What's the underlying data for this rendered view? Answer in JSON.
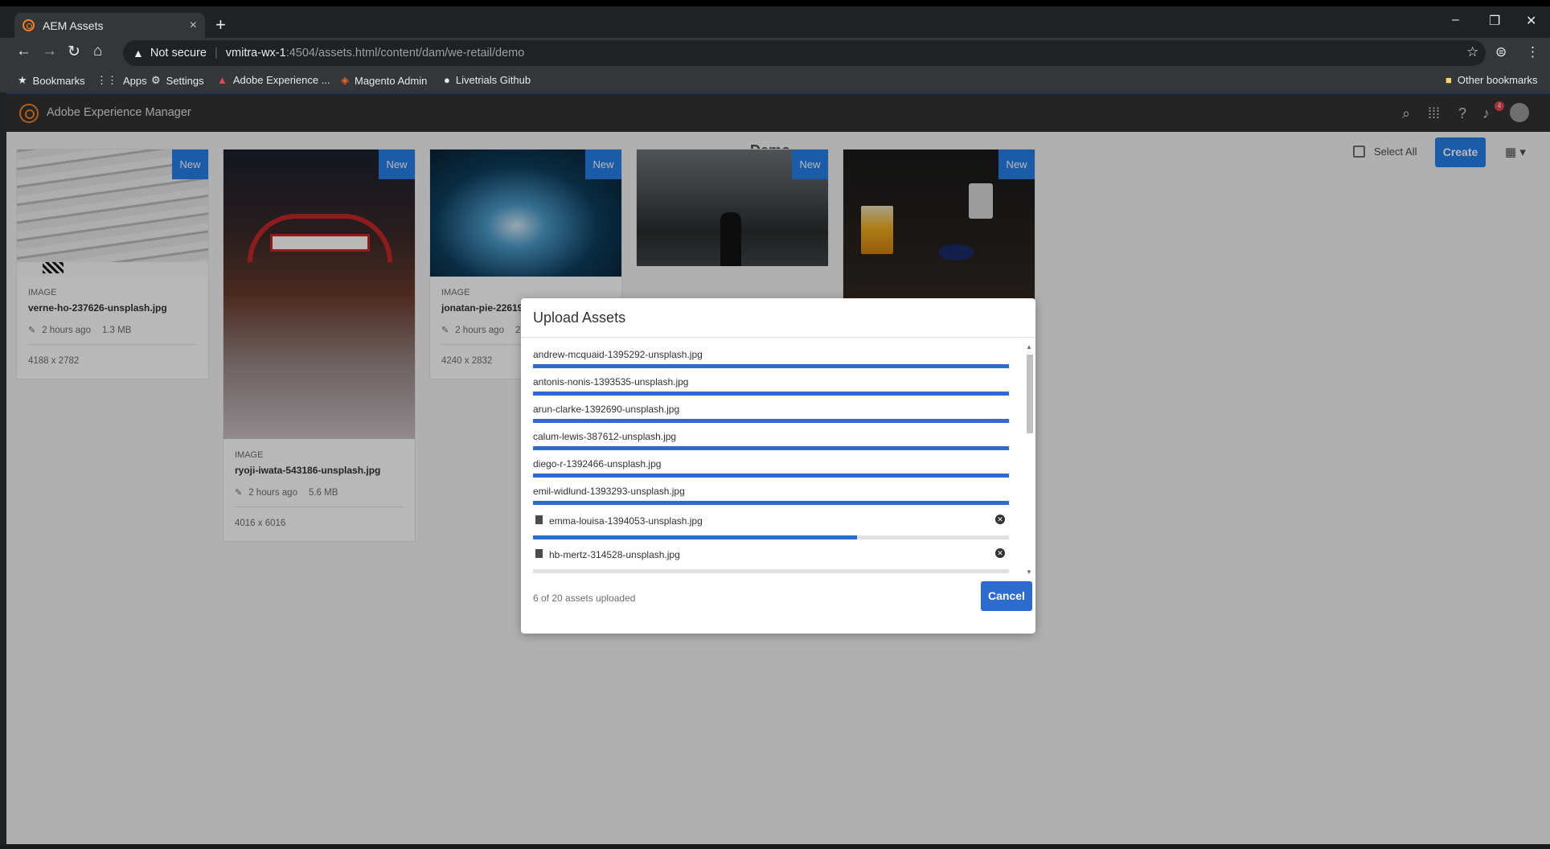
{
  "browser": {
    "tab_title": "AEM Assets",
    "tab_close": "×",
    "new_tab": "+",
    "address": {
      "security": "Not secure",
      "host": "vmitra-wx-1",
      "path": ":4504/assets.html/content/dam/we-retail/demo"
    },
    "window_controls": [
      "–",
      "❐",
      "✕"
    ],
    "bookmarks": [
      {
        "label": "Bookmarks",
        "icon": "star-icon"
      },
      {
        "label": "Apps",
        "icon": "apps-grid-icon"
      },
      {
        "label": "Settings",
        "icon": "gear-icon"
      },
      {
        "label": "Adobe Experience ...",
        "icon": "adobe-icon"
      },
      {
        "label": "Magento Admin",
        "icon": "magento-icon"
      },
      {
        "label": "Livetrials Github",
        "icon": "github-icon"
      }
    ],
    "other_bookmarks": "Other bookmarks"
  },
  "aem": {
    "product_title": "Adobe Experience Manager",
    "notification_count": "4",
    "folder_title": "Demo",
    "select_all_label": "Select All",
    "create_label": "Create",
    "new_badge": "New",
    "cards": [
      {
        "type": "IMAGE",
        "filename": "verne-ho-237626-unsplash.jpg",
        "modified": "2 hours ago",
        "size": "1.3 MB",
        "dimensions": "4188 x 2782"
      },
      {
        "type": "IMAGE",
        "filename": "ryoji-iwata-543186-unsplash.jpg",
        "modified": "2 hours ago",
        "size": "5.6 MB",
        "dimensions": "4016 x 6016"
      },
      {
        "type": "IMAGE",
        "filename": "jonatan-pie-22619",
        "modified": "2 hours ago",
        "size": "2",
        "dimensions": "4240 x 2832"
      },
      {
        "type": "",
        "filename": "",
        "modified": "",
        "size": "",
        "dimensions": ""
      },
      {
        "type": "",
        "filename": "",
        "modified": "",
        "size": "",
        "dimensions": ""
      }
    ]
  },
  "upload_dialog": {
    "title": "Upload Assets",
    "items": [
      {
        "filename": "andrew-mcquaid-1395292-unsplash.jpg",
        "progress": 1.0
      },
      {
        "filename": "antonis-nonis-1393535-unsplash.jpg",
        "progress": 1.0
      },
      {
        "filename": "arun-clarke-1392690-unsplash.jpg",
        "progress": 1.0
      },
      {
        "filename": "calum-lewis-387612-unsplash.jpg",
        "progress": 1.0
      },
      {
        "filename": "diego-r-1392466-unsplash.jpg",
        "progress": 1.0
      },
      {
        "filename": "emil-widlund-1393293-unsplash.jpg",
        "progress": 1.0
      },
      {
        "filename": "emma-louisa-1394053-unsplash.jpg",
        "progress": 0.68
      },
      {
        "filename": "hb-mertz-314528-unsplash.jpg",
        "progress": 0.0
      }
    ],
    "status": "6 of 20 assets uploaded",
    "cancel_label": "Cancel"
  },
  "colors": {
    "accent": "#2680eb",
    "progress": "#2d6ccf",
    "header": "#323232"
  }
}
